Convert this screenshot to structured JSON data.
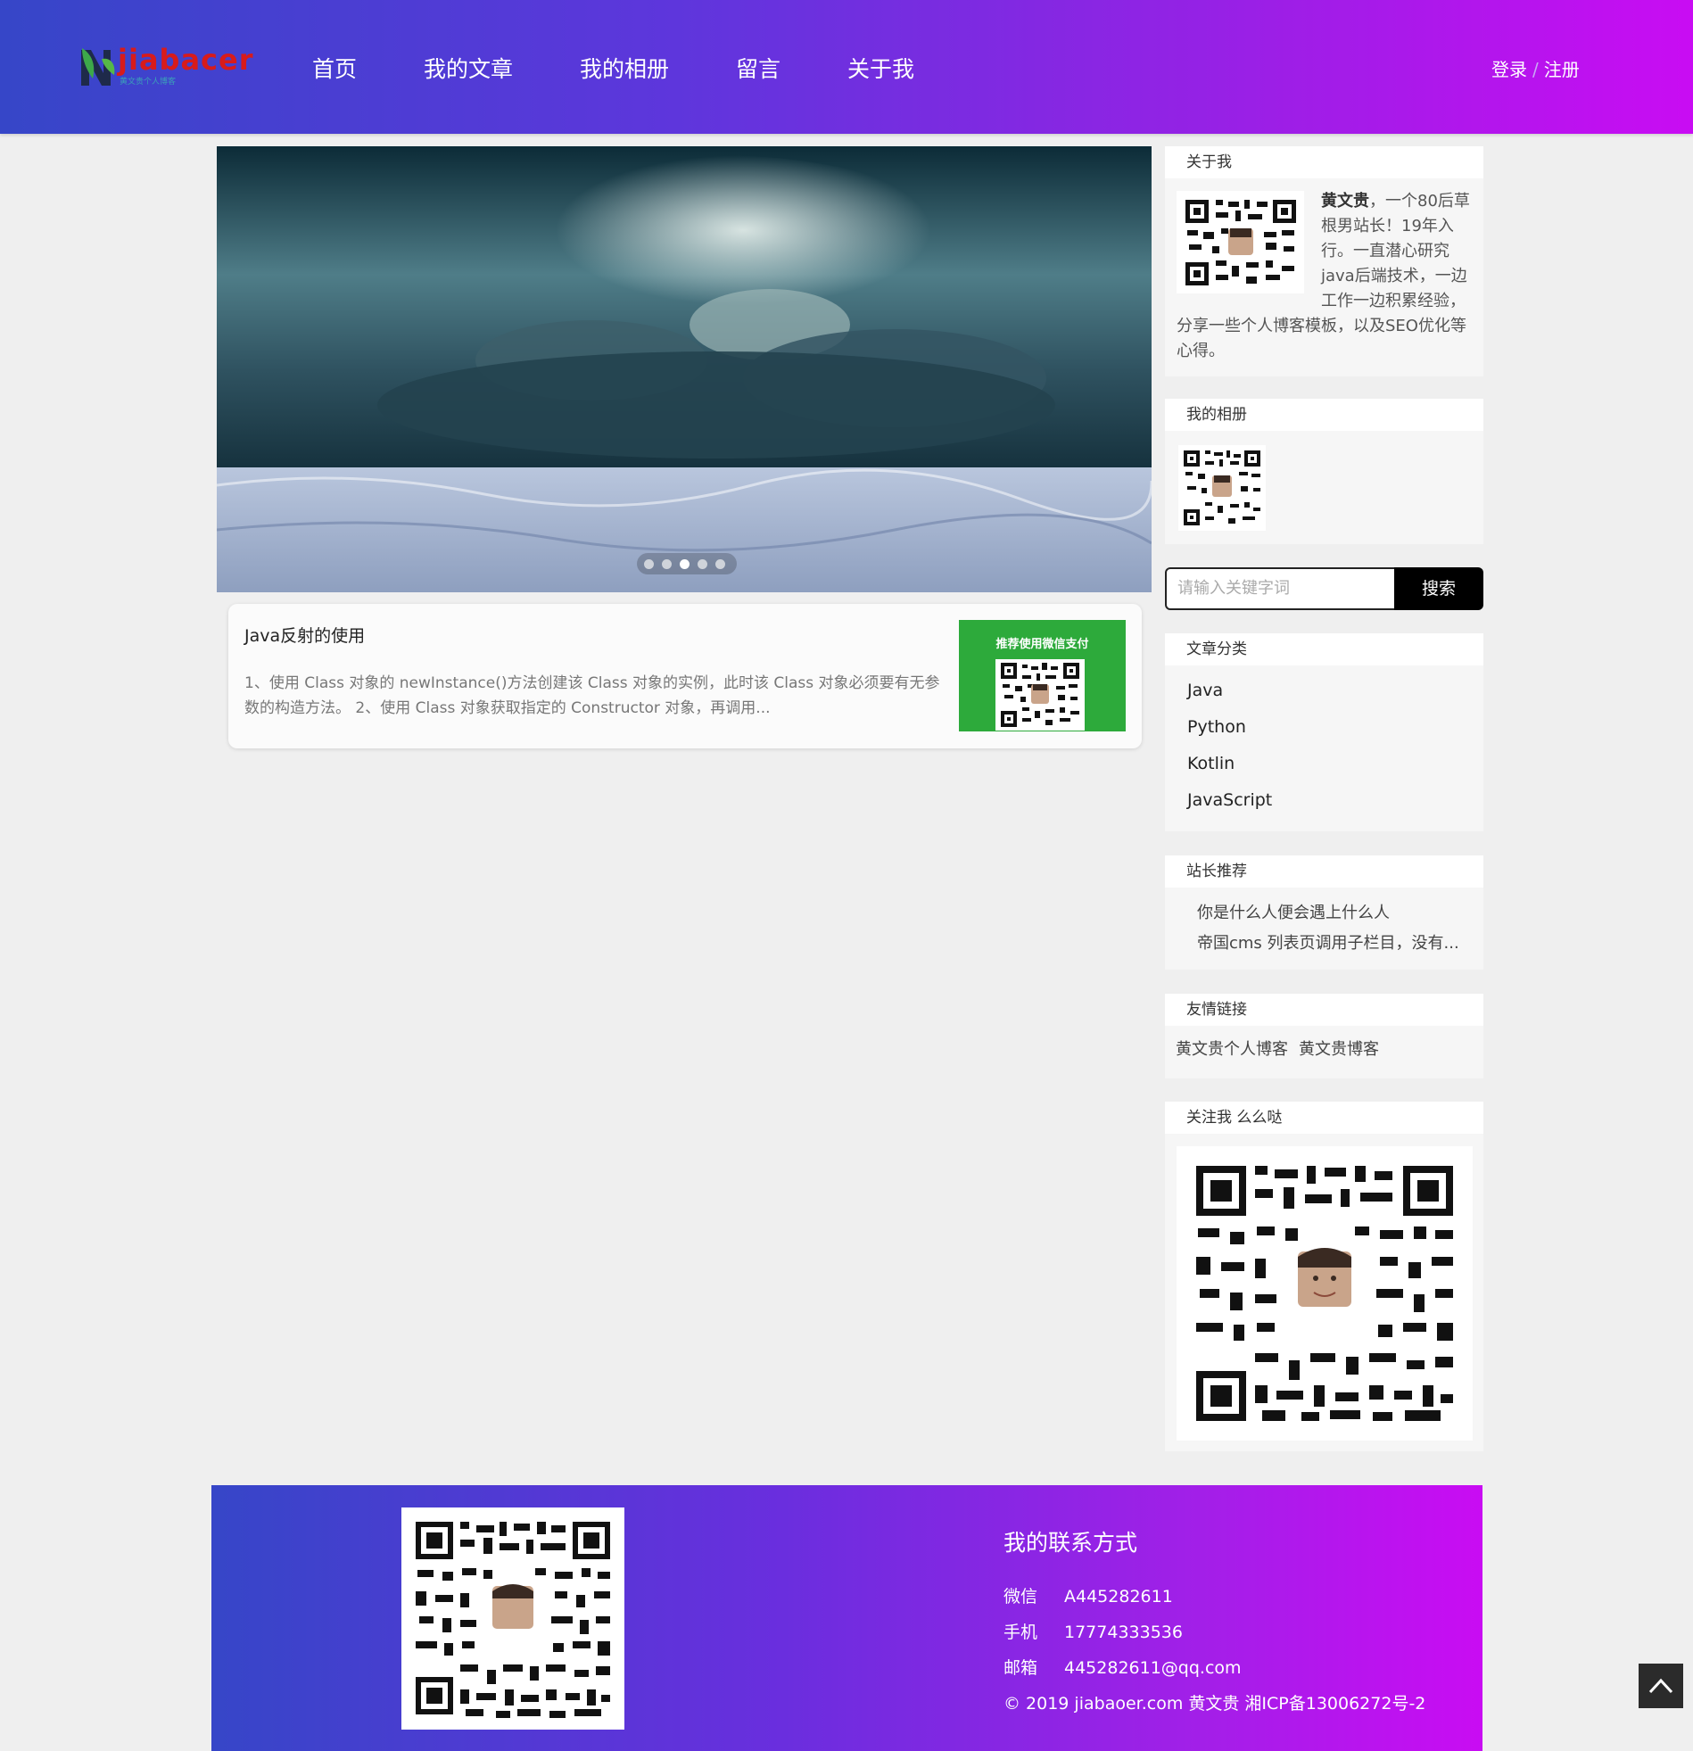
{
  "logo": {
    "text": "jiabacer",
    "subtitle": "黄文贵个人博客"
  },
  "nav": [
    "首页",
    "我的文章",
    "我的相册",
    "留言",
    "关于我"
  ],
  "auth": {
    "login": "登录",
    "separator": "/",
    "register": "注册"
  },
  "banner": {
    "slide_count": 5,
    "active_slide": 3
  },
  "post": {
    "title": "Java反射的使用",
    "summary": "1、使用 Class 对象的 newInstance()方法创建该 Class 对象的实例，此时该 Class 对象必须要有无参数的构造方法。 2、使用 Class 对象获取指定的 Constructor 对象，再调用...",
    "pay_label": "推荐使用微信支付"
  },
  "about": {
    "title": "关于我",
    "name": "黄文贵",
    "text": "，一个80后草根男站长！19年入行。一直潜心研究java后端技术，一边工作一边积累经验，分享一些个人博客模板，以及SEO优化等心得。"
  },
  "album": {
    "title": "我的相册"
  },
  "search": {
    "placeholder": "请输入关键字词",
    "button": "搜索"
  },
  "categories": {
    "title": "文章分类",
    "items": [
      "Java",
      "Python",
      "Kotlin",
      "JavaScript"
    ]
  },
  "recommend": {
    "title": "站长推荐",
    "items": [
      "你是什么人便会遇上什么人",
      "帝国cms 列表页调用子栏目，没有..."
    ]
  },
  "links": {
    "title": "友情链接",
    "items": [
      "黄文贵个人博客",
      "黄文贵博客"
    ]
  },
  "follow": {
    "title": "关注我 么么哒"
  },
  "footer": {
    "contact_title": "我的联系方式",
    "contacts": [
      {
        "label": "微信",
        "value": "A445282611"
      },
      {
        "label": "手机",
        "value": "17774333536"
      },
      {
        "label": "邮箱",
        "value": "445282611@qq.com"
      }
    ],
    "copyright": "© 2019 jiabaoer.com 黄文贵 湘ICP备13006272号-2"
  },
  "colors": {
    "header_start": "#3646c8",
    "header_end": "#c90cf3",
    "pay_green": "#2daa3b"
  }
}
